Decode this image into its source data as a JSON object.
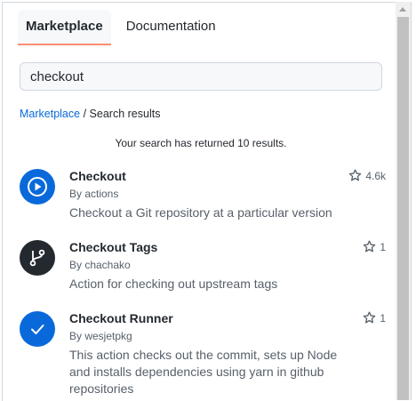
{
  "tabs": [
    {
      "label": "Marketplace",
      "active": true
    },
    {
      "label": "Documentation",
      "active": false
    }
  ],
  "search": {
    "value": "checkout"
  },
  "breadcrumb": {
    "root": "Marketplace",
    "separator": "/",
    "current": "Search results"
  },
  "result_count_text": "Your search has returned 10 results.",
  "results": [
    {
      "title": "Checkout",
      "by": "By actions",
      "description": "Checkout a Git repository at a particular version",
      "stars": "4.6k",
      "icon": "play-icon",
      "icon_bg": "#0969da"
    },
    {
      "title": "Checkout Tags",
      "by": "By chachako",
      "description": "Action for checking out upstream tags",
      "stars": "1",
      "icon": "git-branch-icon",
      "icon_bg": "#24292f"
    },
    {
      "title": "Checkout Runner",
      "by": "By wesjetpkg",
      "description": "This action checks out the commit, sets up Node and installs dependencies using yarn in github repositories",
      "stars": "1",
      "icon": "checkmark-icon",
      "icon_bg": "#0969da"
    }
  ],
  "colors": {
    "accent": "#0969da",
    "tab_underline": "#fd8c73",
    "text": "#24292f",
    "muted": "#57606a"
  }
}
